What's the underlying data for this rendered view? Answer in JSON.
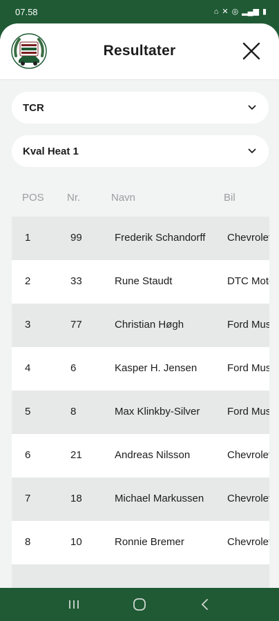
{
  "status_bar": {
    "time": "07.58",
    "icons": [
      "home-icon",
      "mute-icon",
      "hotspot-icon",
      "signal-icon",
      "battery-icon"
    ]
  },
  "header": {
    "title": "Resultater",
    "logo_text": "CLASSIC HALD RACING"
  },
  "filters": {
    "class_select": {
      "value": "TCR"
    },
    "session_select": {
      "value": "Kval Heat 1"
    }
  },
  "columns": [
    "POS",
    "Nr.",
    "Navn",
    "Bil"
  ],
  "rows": [
    {
      "pos": "1",
      "nr": "99",
      "name": "Frederik Schandorff",
      "car": "Chevrolet"
    },
    {
      "pos": "2",
      "nr": "33",
      "name": "Rune Staudt",
      "car": "DTC Motorsport"
    },
    {
      "pos": "3",
      "nr": "77",
      "name": "Christian Høgh",
      "car": "Ford Mustang"
    },
    {
      "pos": "4",
      "nr": "6",
      "name": "Kasper H. Jensen",
      "car": "Ford Mustang"
    },
    {
      "pos": "5",
      "nr": "8",
      "name": "Max Klinkby-Silver",
      "car": "Ford Mustang"
    },
    {
      "pos": "6",
      "nr": "21",
      "name": "Andreas Nilsson",
      "car": "Chevrolet"
    },
    {
      "pos": "7",
      "nr": "18",
      "name": "Michael Markussen",
      "car": "Chevrolet"
    },
    {
      "pos": "8",
      "nr": "10",
      "name": "Ronnie Bremer",
      "car": "Chevrolet"
    },
    {
      "pos": "",
      "nr": "",
      "name": "",
      "car": ""
    }
  ],
  "colors": {
    "brand_green": "#1f5a34",
    "row_alt": "#e6e9e8",
    "background": "#f2f3f3",
    "header_text": "#9a9ea0"
  }
}
